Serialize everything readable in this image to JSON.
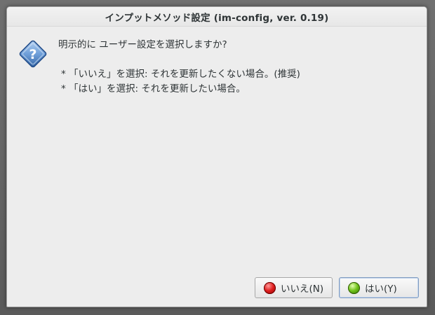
{
  "window": {
    "title": "インプットメソッド設定 (im-config, ver. 0.19)"
  },
  "dialog": {
    "icon": "question-icon",
    "question": "明示的に ユーザー設定を選択しますか?",
    "bullets": [
      "* 「いいえ」を選択: それを更新したくない場合。(推奨)",
      "* 「はい」を選択: それを更新したい場合。"
    ]
  },
  "buttons": {
    "no": {
      "label": "いいえ(N)",
      "icon": "red-led-icon",
      "color": "#e02020"
    },
    "yes": {
      "label": "はい(Y)",
      "icon": "green-led-icon",
      "color": "#6fc21a"
    }
  }
}
